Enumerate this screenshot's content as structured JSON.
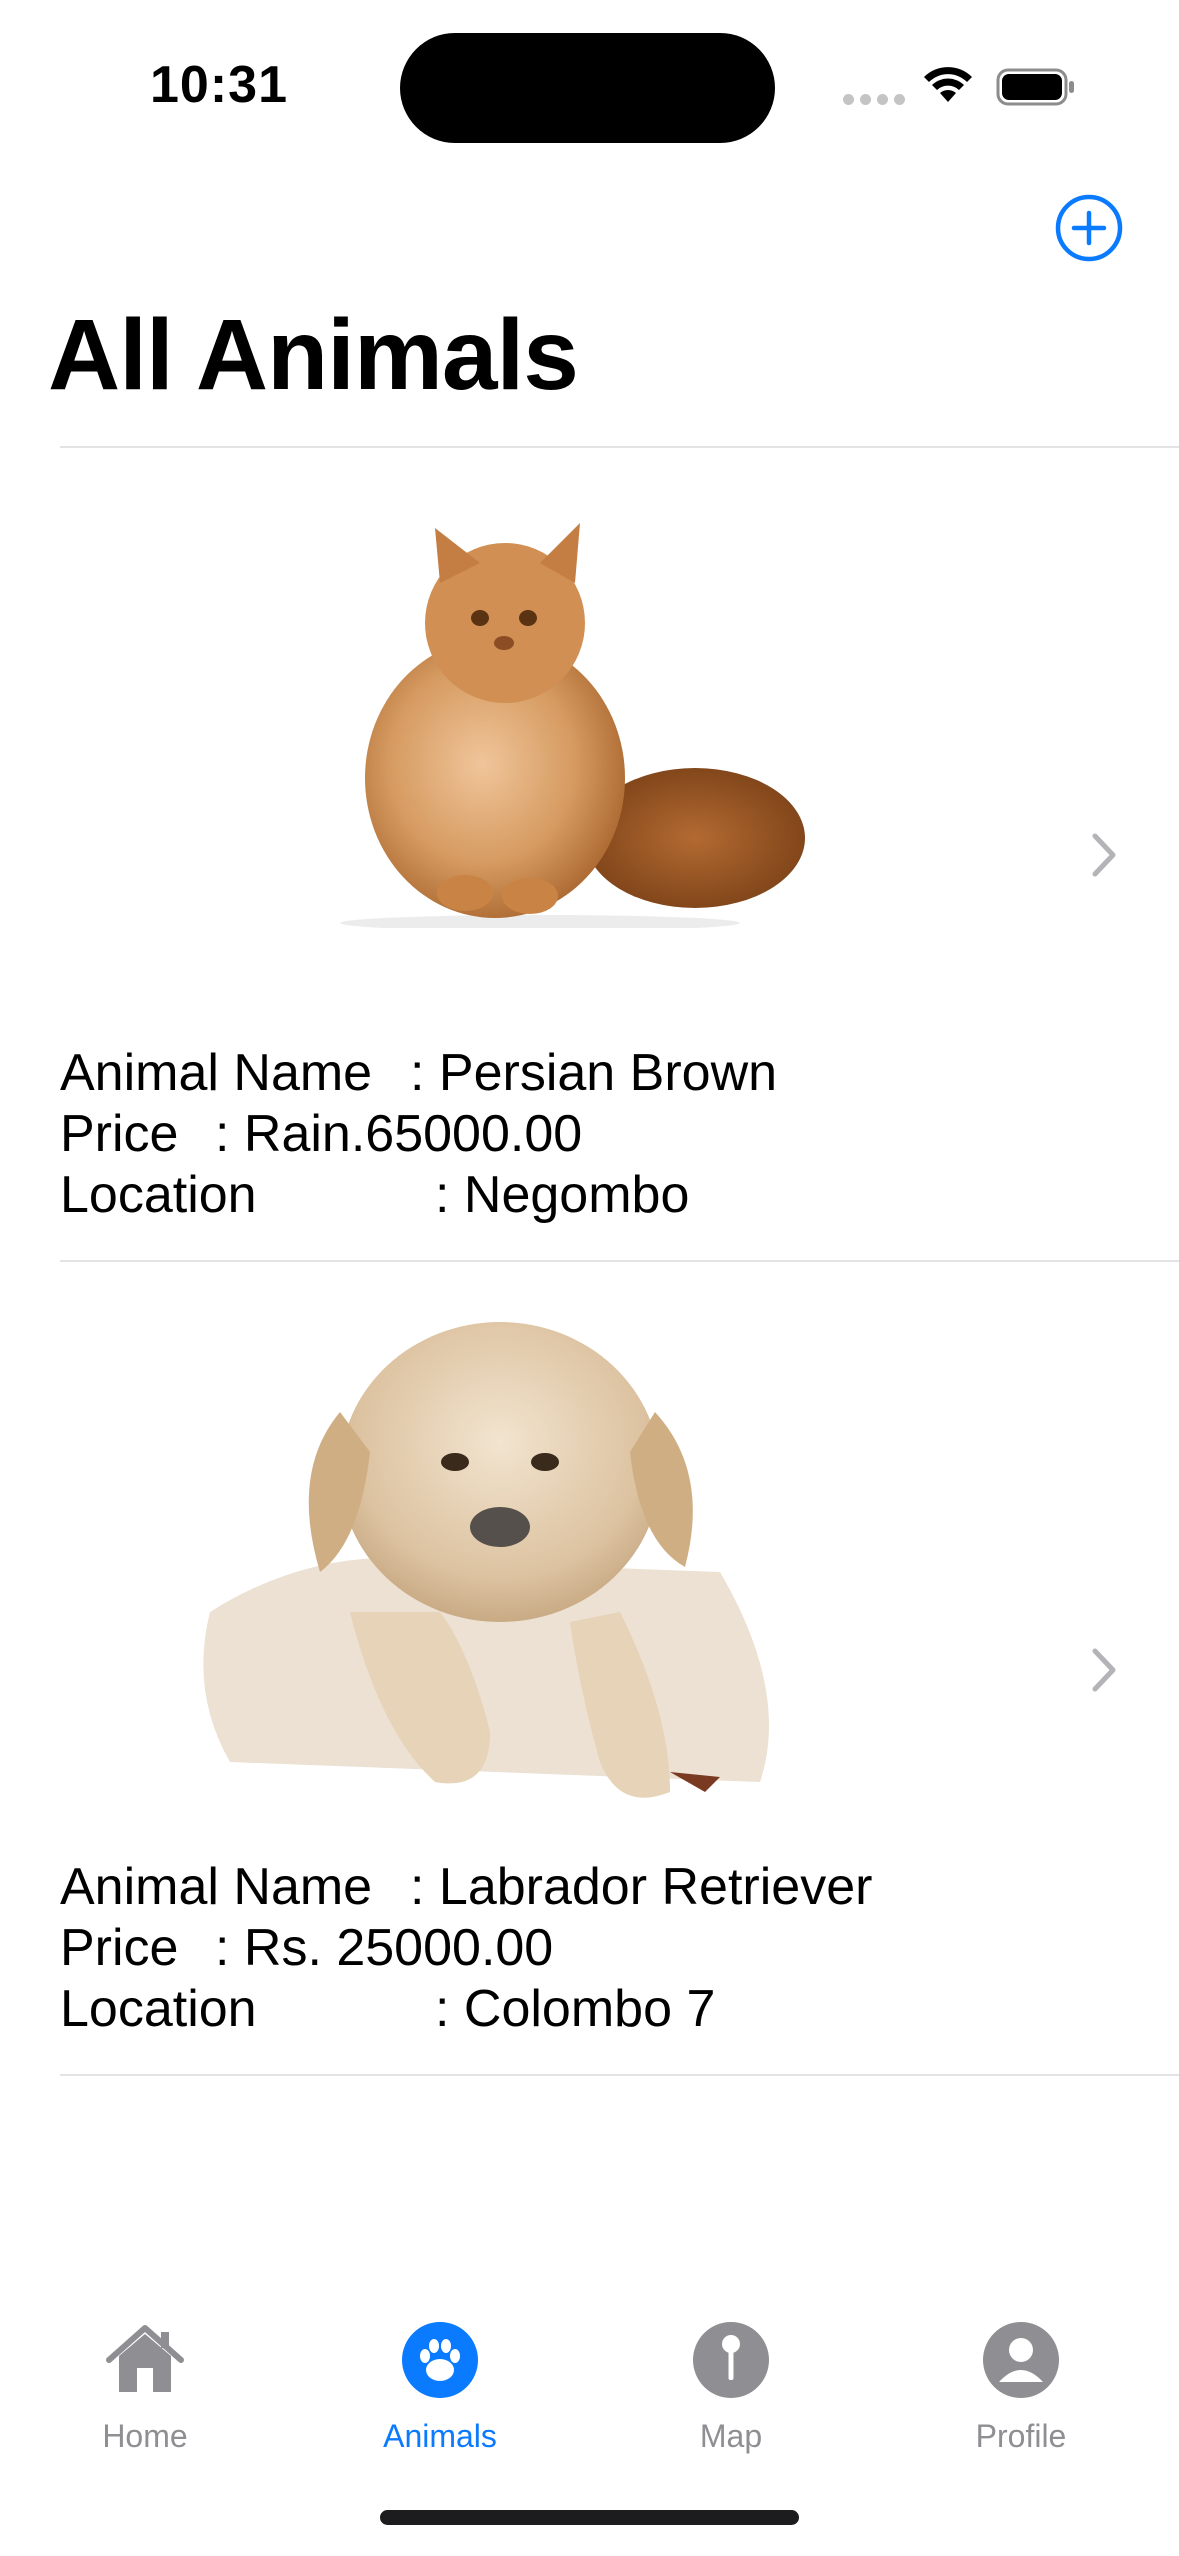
{
  "status_bar": {
    "time": "10:31"
  },
  "nav": {
    "title": "All Animals",
    "add_icon": "plus-circle-icon"
  },
  "animals": [
    {
      "image": "persian-cat-photo",
      "name_label": "Animal Name",
      "name_value": ": Persian Brown",
      "price_label": "Price",
      "price_value": ": Rain.65000.00",
      "location_label": "Location",
      "location_value": ": Negombo"
    },
    {
      "image": "labrador-puppy-photo",
      "name_label": "Animal Name",
      "name_value": ": Labrador Retriever",
      "price_label": "Price",
      "price_value": ": Rs. 25000.00",
      "location_label": "Location",
      "location_value": ": Colombo 7"
    }
  ],
  "tabbar": {
    "active": "Animals",
    "active_color": "#0a7aff",
    "inactive_color": "#8e8e93",
    "tabs": [
      {
        "label": "Home",
        "icon": "house-icon"
      },
      {
        "label": "Animals",
        "icon": "paw-icon"
      },
      {
        "label": "Map",
        "icon": "map-pin-icon"
      },
      {
        "label": "Profile",
        "icon": "person-icon"
      }
    ]
  }
}
